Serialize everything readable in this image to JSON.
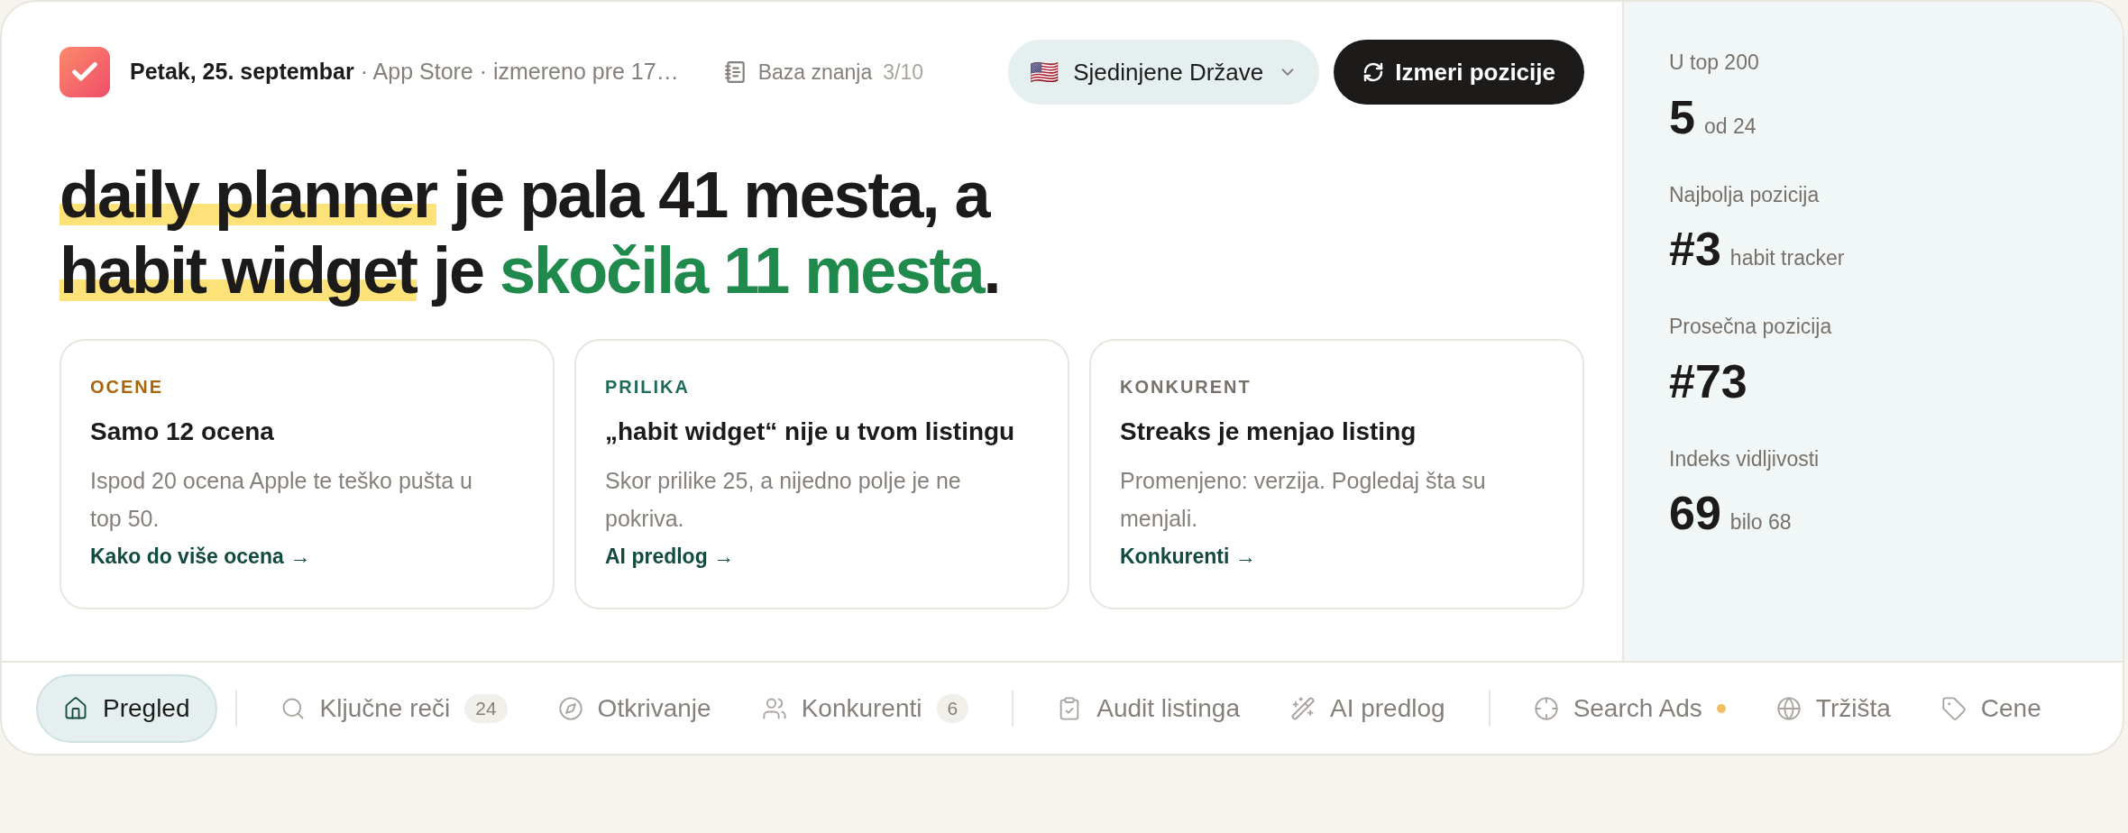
{
  "header": {
    "date": "Petak, 25. septembar",
    "meta": " · App Store · izmereno pre 17…",
    "knowledge": {
      "label": "Baza znanja",
      "count": "3/10"
    },
    "country": {
      "flag": "🇺🇸",
      "label": "Sjedinjene Države"
    },
    "action": "Izmeri pozicije"
  },
  "headline_lines": [
    [
      {
        "text": "daily planner",
        "kind": "highlight"
      },
      {
        "text": " je pala 41 mesta, a",
        "kind": "plain"
      }
    ],
    [
      {
        "text": "habit widget",
        "kind": "highlight"
      },
      {
        "text": " je ",
        "kind": "plain"
      },
      {
        "text": "skočila 11 mesta",
        "kind": "accent"
      },
      {
        "text": ".",
        "kind": "plain"
      }
    ]
  ],
  "cards": [
    {
      "category": "OCENE",
      "color": "#a8650a",
      "title": "Samo 12 ocena",
      "text": "Ispod 20 ocena Apple te teško pušta u top 50.",
      "link": "Kako do više ocena →"
    },
    {
      "category": "PRILIKA",
      "color": "#1f6b5a",
      "title": "„habit widget“ nije u tvom listingu",
      "text": "Skor prilike 25, a nijedno polje je ne pokriva.",
      "link": "AI predlog →"
    },
    {
      "category": "KONKURENT",
      "color": "#77716a",
      "title": "Streaks je menjao listing",
      "text": "Promenjeno: verzija. Pogledaj šta su menjali.",
      "link": "Konkurenti →"
    }
  ],
  "stats": [
    {
      "label": "U top 200",
      "value": "5",
      "note": "od 24"
    },
    {
      "label": "Najbolja pozicija",
      "value": "#3",
      "note": "habit tracker"
    },
    {
      "label": "Prosečna pozicija",
      "value": "#73"
    },
    {
      "label": "Indeks vidljivosti",
      "value": "69",
      "note": "bilo 68"
    }
  ],
  "nav_groups": [
    [
      {
        "label": "Pregled",
        "selected": true,
        "notification": false
      }
    ],
    [
      {
        "label": "Ključne reči",
        "selected": false,
        "badge": "24",
        "notification": false
      },
      {
        "label": "Otkrivanje",
        "selected": false,
        "notification": false
      },
      {
        "label": "Konkurenti",
        "selected": false,
        "badge": "6",
        "notification": false
      }
    ],
    [
      {
        "label": "Audit listinga",
        "selected": false,
        "notification": false
      },
      {
        "label": "AI predlog",
        "selected": false,
        "notification": false
      }
    ],
    [
      {
        "label": "Search Ads",
        "selected": false,
        "notification": true
      },
      {
        "label": "Tržišta",
        "selected": false,
        "notification": false
      },
      {
        "label": "Cene",
        "selected": false,
        "notification": false
      }
    ]
  ]
}
